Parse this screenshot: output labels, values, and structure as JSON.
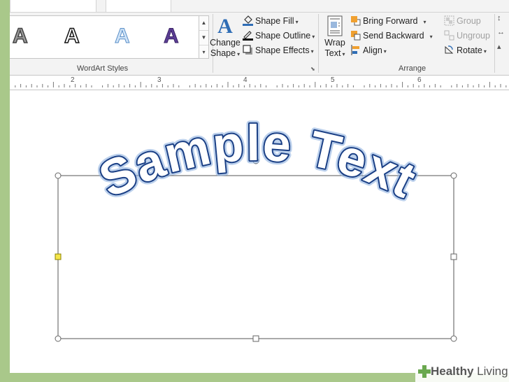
{
  "ribbon": {
    "wordart_styles": {
      "label": "WordArt Styles",
      "samples": [
        {
          "glyph": "A",
          "name": "gray-gradient"
        },
        {
          "glyph": "A",
          "name": "black-outline"
        },
        {
          "glyph": "A",
          "name": "light-blue"
        },
        {
          "glyph": "A",
          "name": "purple"
        }
      ]
    },
    "change_shape": {
      "line1": "Change",
      "line2": "Shape"
    },
    "shape_format": {
      "fill": "Shape Fill",
      "outline": "Shape Outline",
      "effects": "Shape Effects"
    },
    "wrap_text": {
      "line1": "Wrap",
      "line2": "Text"
    },
    "arrange": {
      "label": "Arrange",
      "bring_forward": "Bring Forward",
      "send_backward": "Send Backward",
      "align": "Align",
      "group": "Group",
      "ungroup": "Ungroup",
      "rotate": "Rotate"
    }
  },
  "ruler": {
    "numbers": [
      "2",
      "3",
      "4",
      "5",
      "6"
    ]
  },
  "document": {
    "wordart_text": "Sample Text"
  },
  "watermark": {
    "brand_bold": "Healthy",
    "brand_light": "Living"
  },
  "colors": {
    "background": "#a9c88a",
    "wordart_outline": "#1a3f85",
    "wordart_glow": "#8fb1e0",
    "accent_blue": "#2f6db5"
  }
}
